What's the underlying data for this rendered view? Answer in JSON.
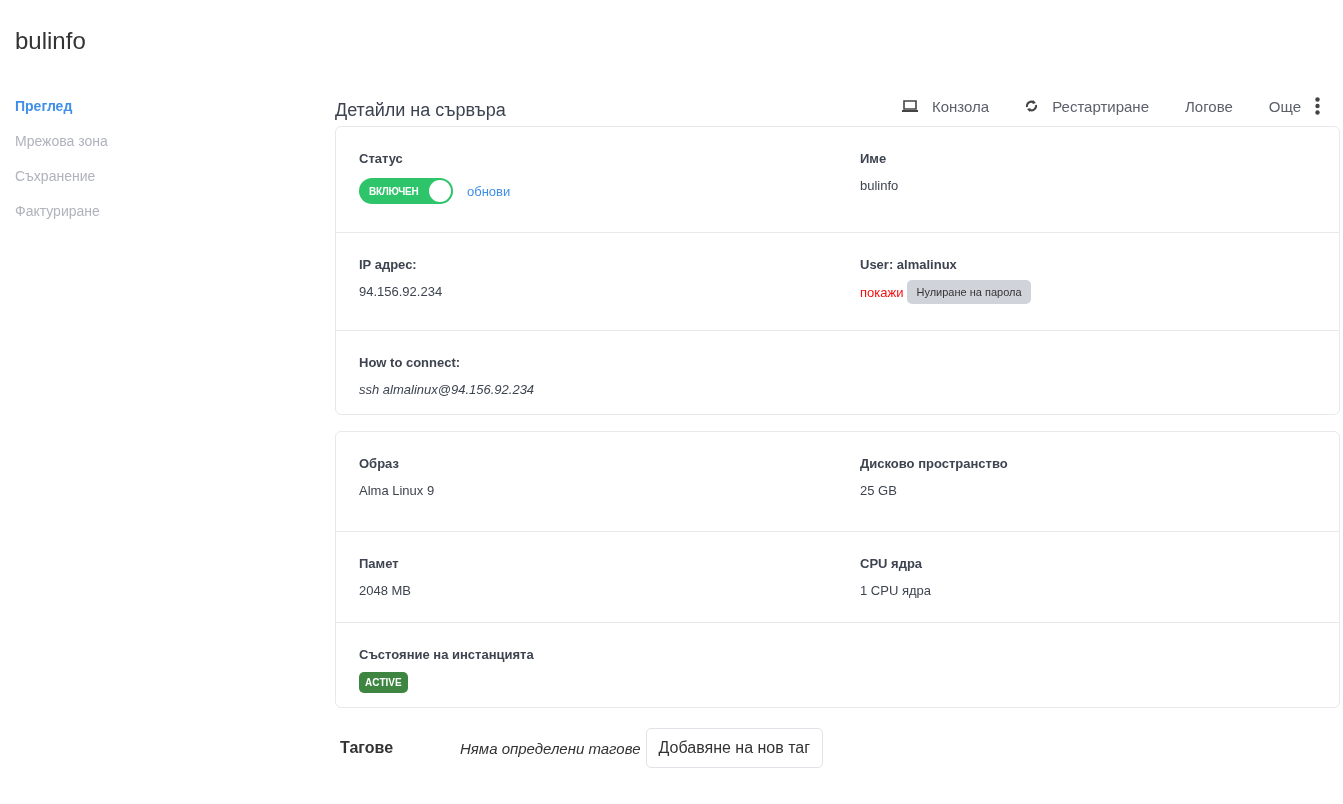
{
  "title": "bulinfo",
  "sidebar": {
    "items": [
      {
        "label": "Преглед",
        "selected": true
      },
      {
        "label": "Мрежова зона",
        "selected": false
      },
      {
        "label": "Съхранение",
        "selected": false
      },
      {
        "label": "Фактуриране",
        "selected": false
      }
    ]
  },
  "header": {
    "title": "Детайли на сървъра",
    "actions": [
      {
        "label": "Конзола",
        "kind": "laptop"
      },
      {
        "label": "Рестартиране",
        "kind": "refresh"
      },
      {
        "label": "Логове",
        "kind": "plain"
      },
      {
        "label": "Още",
        "kind": "more"
      }
    ]
  },
  "cards": [
    {
      "rows": [
        {
          "cells": [
            {
              "kind": "toggle",
              "label": "Статус",
              "toggle_text": "ВКЛЮЧЕН",
              "on": true,
              "link": "обнови"
            },
            {
              "kind": "text",
              "label": "Име",
              "value": "bulinfo"
            }
          ]
        },
        {
          "cells": [
            {
              "kind": "text",
              "label": "IP адрес:",
              "value": "94.156.92.234"
            },
            {
              "kind": "password",
              "label": "User: almalinux",
              "link": "покажи",
              "button": "Нулиране на парола"
            }
          ]
        },
        {
          "cells": [
            {
              "kind": "italic",
              "label": "How to connect:",
              "value": "ssh almalinux@94.156.92.234"
            }
          ]
        }
      ]
    },
    {
      "rows": [
        {
          "cells": [
            {
              "kind": "text",
              "label": "Образ",
              "value": "Alma Linux 9"
            },
            {
              "kind": "text",
              "label": "Дисково пространство",
              "value": "25 GB"
            }
          ]
        },
        {
          "cells": [
            {
              "kind": "text",
              "label": "Памет",
              "value": "2048 MB"
            },
            {
              "kind": "text",
              "label": "CPU ядра",
              "value": "1 CPU ядра"
            }
          ]
        },
        {
          "cells": [
            {
              "kind": "badge",
              "label": "Състояние на инстанцията",
              "badge": "ACTIVE"
            }
          ]
        }
      ]
    }
  ],
  "tags": {
    "label": "Тагове",
    "empty_text": "Няма определени тагове",
    "button": "Добавяне на нов таг"
  }
}
